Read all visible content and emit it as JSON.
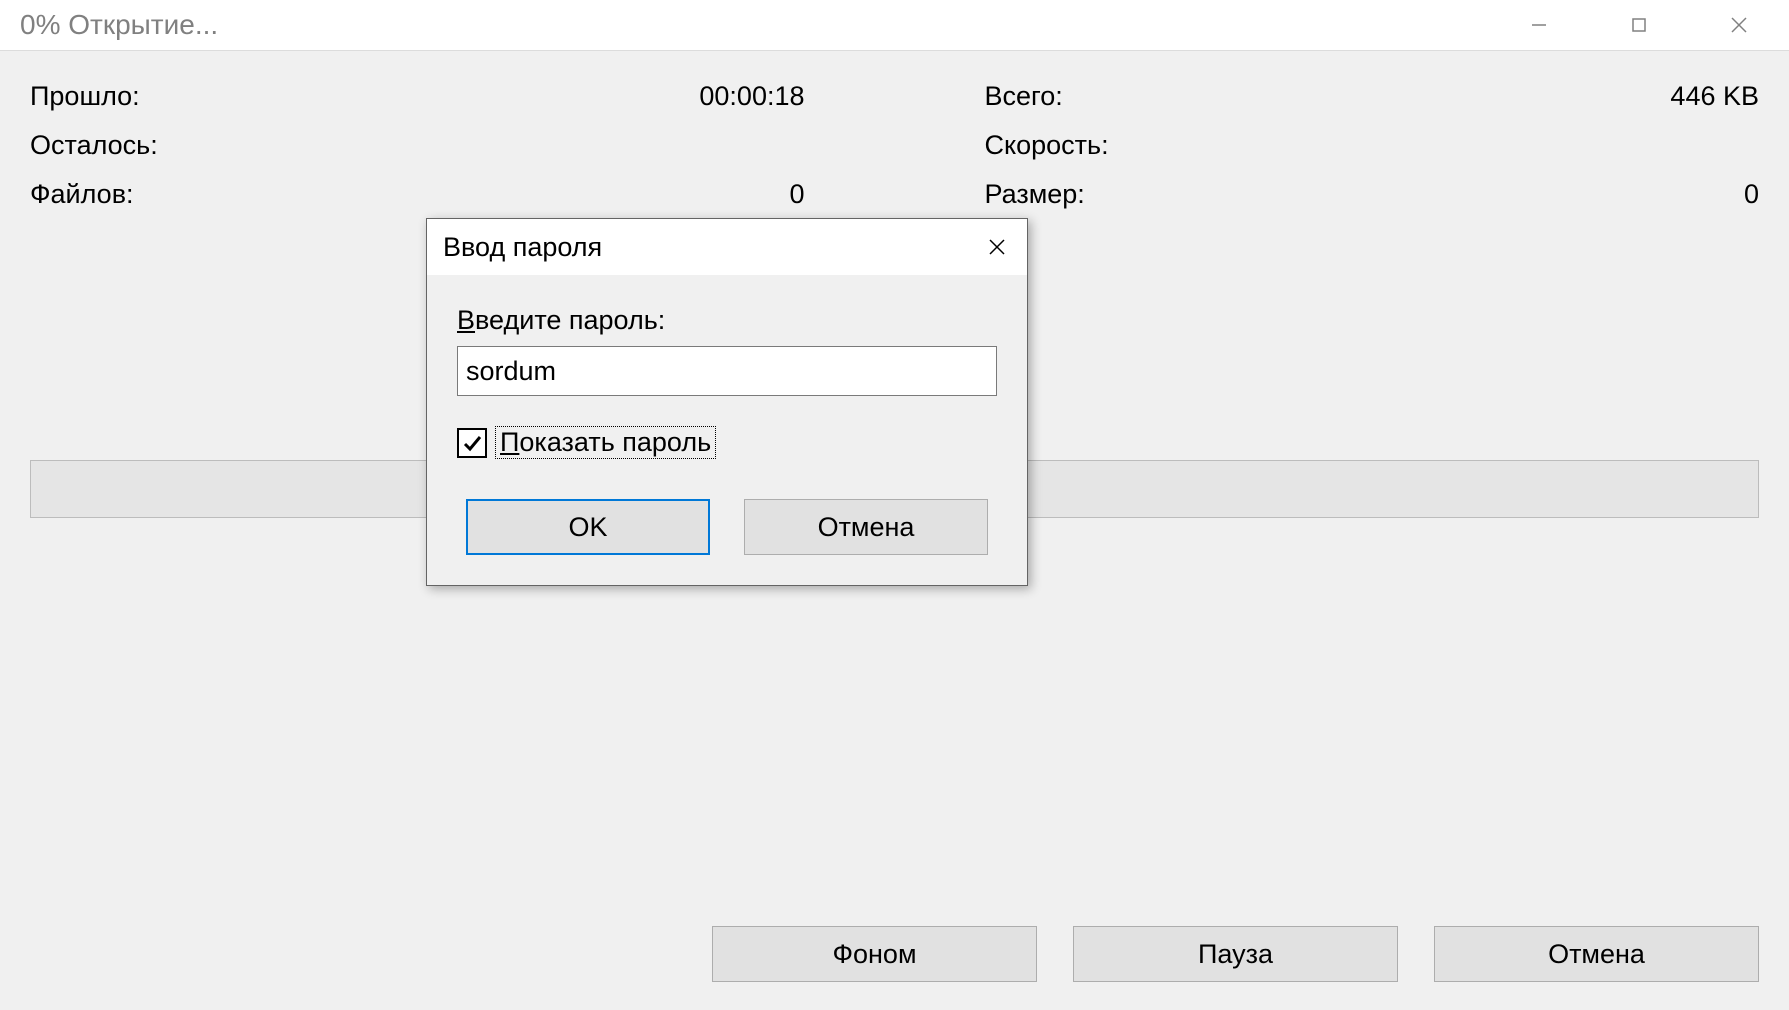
{
  "window": {
    "title": "0% Открытие..."
  },
  "stats": {
    "elapsed_label": "Прошло:",
    "elapsed_value": "00:00:18",
    "total_label": "Всего:",
    "total_value": "446 KB",
    "remaining_label": "Осталось:",
    "remaining_value": "",
    "speed_label": "Скорость:",
    "speed_value": "",
    "files_label": "Файлов:",
    "files_value": "0",
    "size_label": "Размер:",
    "size_value": "0"
  },
  "buttons": {
    "background": "Фоном",
    "pause": "Пауза",
    "cancel": "Отмена"
  },
  "modal": {
    "title": "Ввод пароля",
    "label_first": "В",
    "label_rest": "ведите пароль:",
    "password_value": "sordum",
    "checkbox_first": "П",
    "checkbox_rest": "оказать пароль",
    "ok": "OK",
    "cancel": "Отмена"
  }
}
